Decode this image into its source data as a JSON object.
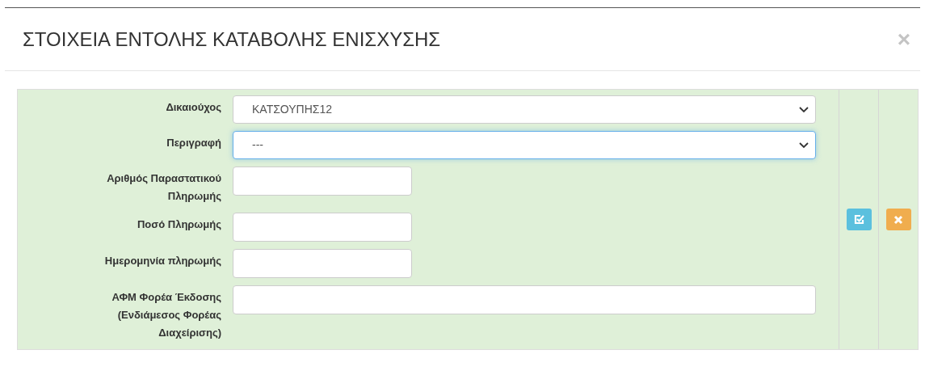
{
  "dialog": {
    "title": "ΣΤΟΙΧΕΙΑ ΕΝΤΟΛΗΣ ΚΑΤΑΒΟΛΗΣ ΕΝΙΣΧΥΣΗΣ",
    "close": "×"
  },
  "fields": [
    {
      "label": "Δικαιούχος",
      "kind": "select",
      "value": "ΚΑΤΣΟΥΠΗΣ12",
      "focused": false
    },
    {
      "label": "Περιγραφή",
      "kind": "select",
      "value": "---",
      "focused": true
    },
    {
      "label": "Αριθμός Παραστατικού Πληρωμής",
      "kind": "short_text",
      "focused": false
    },
    {
      "label": "Ποσό Πληρωμής",
      "kind": "short_text",
      "focused": false
    },
    {
      "label": "Ημερομηνία πληρωμής",
      "kind": "short_text",
      "focused": false
    },
    {
      "label": "ΑΦΜ Φορέα Έκδοσης (Ενδιάμεσος Φορέας Διαχείρισης)",
      "kind": "long_text",
      "focused": false
    }
  ],
  "actions": [
    {
      "kind": "save"
    },
    {
      "kind": "cancel"
    }
  ]
}
